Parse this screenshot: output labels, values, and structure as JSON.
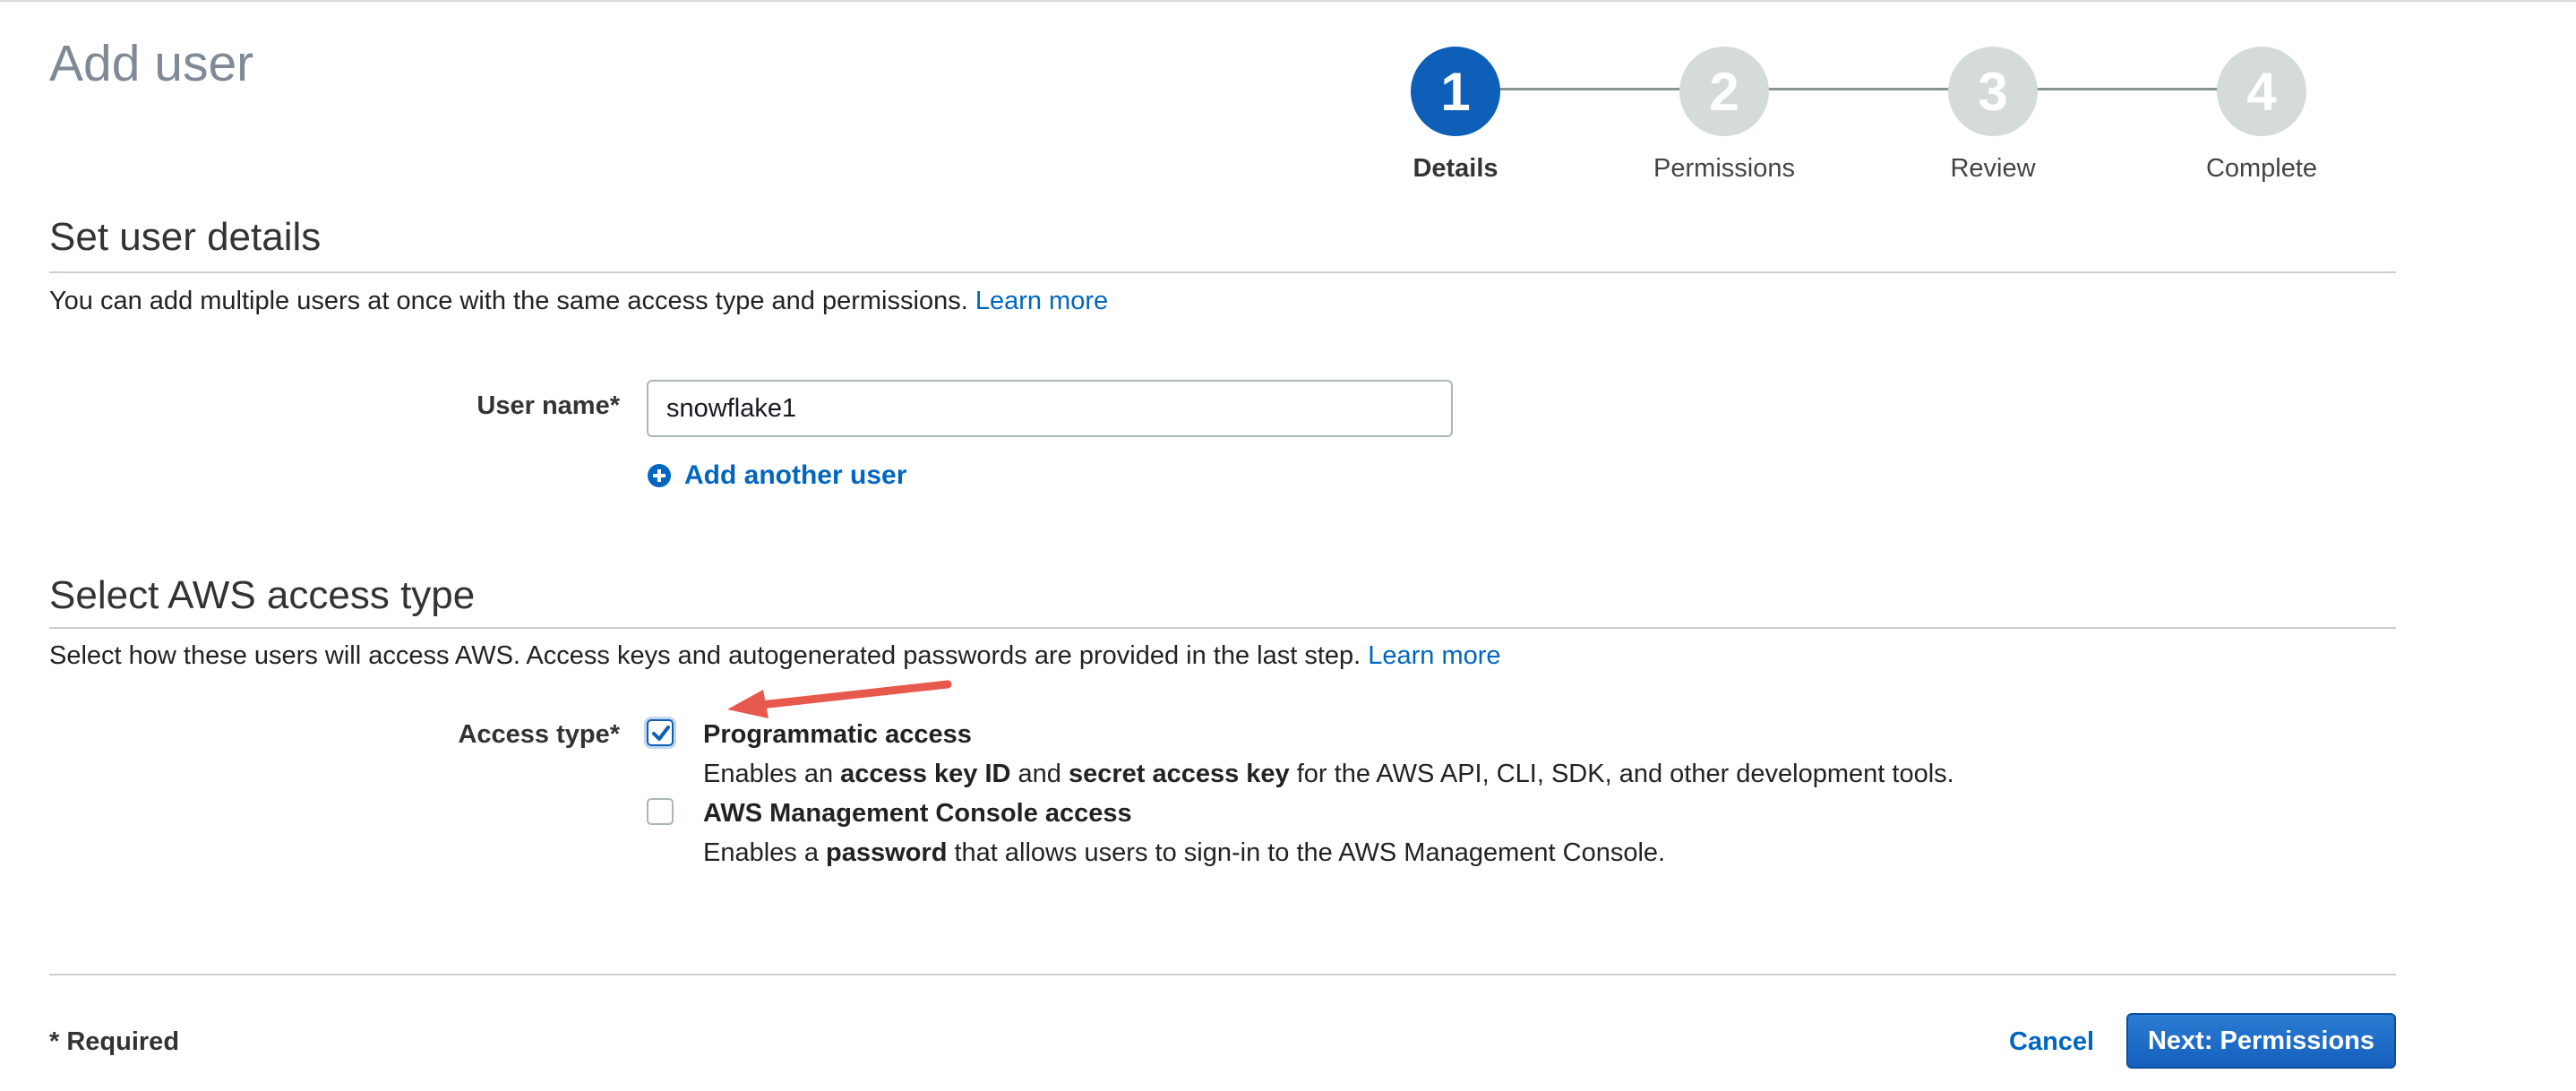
{
  "page": {
    "title": "Add user"
  },
  "stepper": {
    "steps": [
      {
        "number": "1",
        "label": "Details",
        "active": true
      },
      {
        "number": "2",
        "label": "Permissions",
        "active": false
      },
      {
        "number": "3",
        "label": "Review",
        "active": false
      },
      {
        "number": "4",
        "label": "Complete",
        "active": false
      }
    ]
  },
  "details": {
    "title": "Set user details",
    "description": "You can add multiple users at once with the same access type and permissions.",
    "learn_more": "Learn more",
    "username_label": "User name*",
    "username_value": "snowflake1",
    "add_another_user": "Add another user"
  },
  "access": {
    "title": "Select AWS access type",
    "description": "Select how these users will access AWS. Access keys and autogenerated passwords are provided in the last step.",
    "learn_more": "Learn more",
    "label": "Access type*",
    "options": [
      {
        "title": "Programmatic access",
        "checked": true,
        "desc_1": "Enables an ",
        "desc_b1": "access key ID",
        "desc_2": " and ",
        "desc_b2": "secret access key",
        "desc_3": " for the AWS API, CLI, SDK, and other development tools."
      },
      {
        "title": "AWS Management Console access",
        "checked": false,
        "desc_1": "Enables a ",
        "desc_b1": "password",
        "desc_2": " that allows users to sign-in to the AWS Management Console."
      }
    ]
  },
  "footer": {
    "required_note": "* Required",
    "cancel_label": "Cancel",
    "next_label": "Next: Permissions"
  },
  "colors": {
    "accent": "#0d5fb8",
    "link": "#0066c0",
    "inactive_step": "#d5dbdb",
    "annotation_arrow": "#e8594d"
  },
  "icons": [
    "plus-circle-icon",
    "checkmark-icon",
    "annotation-arrow"
  ]
}
